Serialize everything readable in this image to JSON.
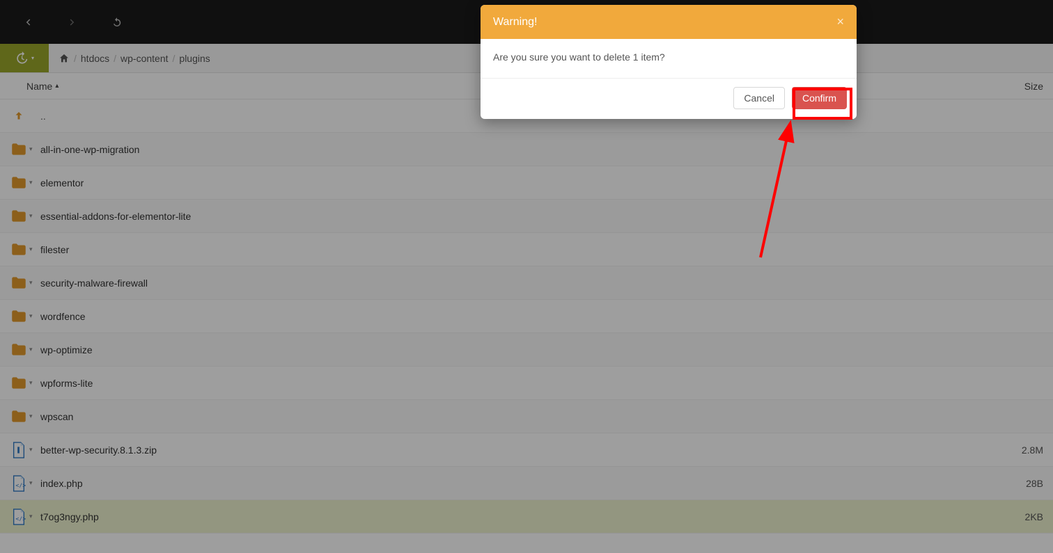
{
  "breadcrumb": {
    "home_label": "home",
    "segments": [
      "htdocs",
      "wp-content",
      "plugins"
    ]
  },
  "columns": {
    "name": "Name",
    "size": "Size"
  },
  "parent_label": "..",
  "rows": [
    {
      "type": "folder",
      "name": "all-in-one-wp-migration",
      "size": ""
    },
    {
      "type": "folder",
      "name": "elementor",
      "size": ""
    },
    {
      "type": "folder",
      "name": "essential-addons-for-elementor-lite",
      "size": ""
    },
    {
      "type": "folder",
      "name": "filester",
      "size": ""
    },
    {
      "type": "folder",
      "name": "security-malware-firewall",
      "size": ""
    },
    {
      "type": "folder",
      "name": "wordfence",
      "size": ""
    },
    {
      "type": "folder",
      "name": "wp-optimize",
      "size": ""
    },
    {
      "type": "folder",
      "name": "wpforms-lite",
      "size": ""
    },
    {
      "type": "folder",
      "name": "wpscan",
      "size": ""
    },
    {
      "type": "zip",
      "name": "better-wp-security.8.1.3.zip",
      "size": "2.8M"
    },
    {
      "type": "php",
      "name": "index.php",
      "size": "28B"
    },
    {
      "type": "php",
      "name": "t7og3ngy.php",
      "size": "2KB",
      "selected": true
    }
  ],
  "modal": {
    "title": "Warning!",
    "body": "Are you sure you want to delete 1 item?",
    "cancel": "Cancel",
    "confirm": "Confirm"
  }
}
